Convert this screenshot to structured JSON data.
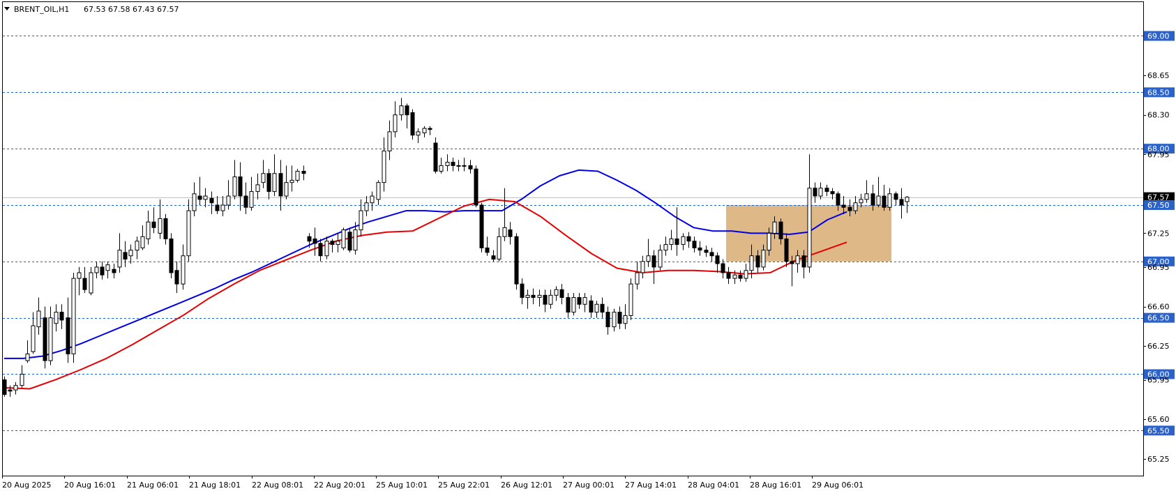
{
  "header": {
    "symbol": "BRENT_OIL,H1",
    "ohlc": "67.53 67.58 67.43 67.57"
  },
  "colors": {
    "background": "#ffffff",
    "frame": "#000000",
    "level_line": "#1f5fc8",
    "level_tag": "#2a62c9",
    "current_price_line": "#c0c0c0",
    "current_price_tag": "#000000",
    "ma_fast": "#0000e6",
    "ma_slow": "#e60000",
    "zone_fill": "#deb887",
    "candle_bull_body": "#ffffff",
    "candle_bear_body": "#000000"
  },
  "icons": {
    "menu": "triangle-down-icon"
  },
  "chart_data": {
    "type": "candlestick",
    "timeframe": "H1",
    "ylim": [
      65.1,
      69.3
    ],
    "y_ticks": [
      "69.00",
      "68.65",
      "68.50",
      "68.30",
      "68.00",
      "67.95",
      "67.57",
      "67.50",
      "67.25",
      "67.00",
      "66.95",
      "66.60",
      "66.50",
      "66.25",
      "66.00",
      "65.95",
      "65.60",
      "65.50",
      "65.25"
    ],
    "x_tick_labels": [
      "20 Aug 2025",
      "20 Aug 16:01",
      "21 Aug 06:01",
      "21 Aug 18:01",
      "22 Aug 08:01",
      "22 Aug 20:01",
      "25 Aug 10:01",
      "25 Aug 22:01",
      "26 Aug 12:01",
      "27 Aug 00:01",
      "27 Aug 14:01",
      "28 Aug 04:01",
      "28 Aug 16:01",
      "29 Aug 06:01"
    ],
    "horizontal_levels": [
      "69.00",
      "68.50",
      "68.00",
      "67.50",
      "67.00",
      "66.50",
      "66.00",
      "65.50"
    ],
    "current_price": "67.57",
    "zone": {
      "time_start": "28 Aug 04:01",
      "time_end": "29 Aug 06:01",
      "price_high": 67.5,
      "price_low": 67.0
    },
    "series": [
      {
        "type": "moving-average",
        "color": "#0000e6",
        "values": [
          66.14,
          66.14,
          66.16,
          66.21,
          66.27,
          66.34,
          66.41,
          66.48,
          66.55,
          66.62,
          66.69,
          66.76,
          66.84,
          66.91,
          66.99,
          67.07,
          67.15,
          67.22,
          67.29,
          67.35,
          67.4,
          67.45,
          67.45,
          67.44,
          67.45,
          67.45,
          67.45,
          67.55,
          67.67,
          67.76,
          67.81,
          67.8,
          67.72,
          67.63,
          67.52,
          67.4,
          67.3,
          67.27,
          67.27,
          67.25,
          67.25,
          67.24,
          67.26,
          67.37,
          67.44
        ],
        "x": [
          "20 Aug 2025",
          "",
          "20 Aug 16:01",
          "",
          "21 Aug 06:01",
          "",
          "21 Aug 18:01",
          "",
          "22 Aug 08:01",
          "",
          "22 Aug 20:01",
          "",
          "25 Aug 10:01",
          "",
          "25 Aug 22:01",
          "",
          "26 Aug 12:01",
          "",
          "27 Aug 00:01",
          "",
          "27 Aug 14:01",
          "",
          "28 Aug 04:01",
          "",
          "28 Aug 16:01",
          "",
          "29 Aug 06:01",
          "",
          "",
          "",
          "",
          "",
          "",
          "",
          "",
          "",
          "",
          "",
          "",
          "",
          "",
          "",
          "",
          "",
          ""
        ]
      },
      {
        "type": "moving-average",
        "color": "#e60000",
        "values": [
          65.88,
          65.87,
          65.95,
          66.04,
          66.14,
          66.26,
          66.39,
          66.52,
          66.67,
          66.8,
          66.92,
          67.01,
          67.1,
          67.18,
          67.23,
          67.26,
          67.27,
          67.38,
          67.49,
          67.55,
          67.53,
          67.4,
          67.23,
          67.07,
          66.94,
          66.9,
          66.92,
          66.92,
          66.91,
          66.89,
          66.9,
          67.01,
          67.09,
          67.17
        ],
        "x": [
          "",
          "",
          "",
          "",
          "",
          "",
          "",
          "",
          "",
          "",
          "",
          "",
          "",
          "",
          "",
          "",
          "",
          "",
          "",
          "",
          "",
          "",
          "",
          "",
          "",
          "",
          "",
          "",
          "",
          "",
          "",
          "",
          "",
          ""
        ]
      }
    ],
    "candles": [
      [
        65.95,
        65.82,
        65.98,
        65.8
      ],
      [
        65.86,
        65.85,
        65.9,
        65.8
      ],
      [
        65.86,
        65.9,
        65.93,
        65.82
      ],
      [
        65.9,
        66.0,
        66.08,
        65.88
      ],
      [
        66.12,
        66.18,
        66.3,
        66.1
      ],
      [
        66.2,
        66.43,
        66.55,
        66.18
      ],
      [
        66.42,
        66.56,
        66.68,
        66.35
      ],
      [
        66.5,
        66.12,
        66.6,
        66.05
      ],
      [
        66.12,
        66.5,
        66.6,
        66.08
      ],
      [
        66.45,
        66.55,
        66.62,
        66.38
      ],
      [
        66.55,
        66.48,
        66.62,
        66.4
      ],
      [
        66.5,
        66.18,
        66.68,
        66.1
      ],
      [
        66.18,
        66.85,
        66.9,
        66.1
      ],
      [
        66.85,
        66.9,
        66.95,
        66.7
      ],
      [
        66.85,
        66.75,
        66.95,
        66.72
      ],
      [
        66.72,
        66.9,
        66.95,
        66.7
      ],
      [
        66.9,
        66.95,
        67.0,
        66.85
      ],
      [
        66.95,
        66.88,
        67.0,
        66.84
      ],
      [
        66.92,
        66.97,
        67.0,
        66.85
      ],
      [
        66.93,
        66.9,
        66.98,
        66.85
      ],
      [
        66.95,
        67.1,
        67.25,
        66.9
      ],
      [
        67.08,
        67.02,
        67.18,
        66.95
      ],
      [
        67.05,
        67.1,
        67.15,
        66.98
      ],
      [
        67.1,
        67.18,
        67.22,
        67.02
      ],
      [
        67.12,
        67.22,
        67.32,
        67.1
      ],
      [
        67.2,
        67.35,
        67.45,
        67.15
      ],
      [
        67.35,
        67.3,
        67.48,
        67.25
      ],
      [
        67.25,
        67.38,
        67.55,
        67.2
      ],
      [
        67.38,
        67.2,
        67.42,
        67.15
      ],
      [
        67.2,
        66.9,
        67.25,
        66.85
      ],
      [
        66.92,
        66.8,
        67.0,
        66.72
      ],
      [
        66.8,
        67.05,
        67.15,
        66.75
      ],
      [
        67.05,
        67.45,
        67.55,
        67.0
      ],
      [
        67.45,
        67.6,
        67.7,
        67.4
      ],
      [
        67.58,
        67.55,
        67.75,
        67.5
      ],
      [
        67.55,
        67.58,
        67.65,
        67.48
      ],
      [
        67.56,
        67.52,
        67.62,
        67.42
      ],
      [
        67.5,
        67.45,
        67.58,
        67.42
      ],
      [
        67.45,
        67.5,
        67.58,
        67.4
      ],
      [
        67.5,
        67.58,
        67.72,
        67.46
      ],
      [
        67.58,
        67.75,
        67.9,
        67.55
      ],
      [
        67.75,
        67.58,
        67.88,
        67.45
      ],
      [
        67.58,
        67.48,
        67.7,
        67.42
      ],
      [
        67.48,
        67.62,
        67.75,
        67.45
      ],
      [
        67.62,
        67.68,
        67.78,
        67.55
      ],
      [
        67.7,
        67.78,
        67.9,
        67.65
      ],
      [
        67.78,
        67.62,
        67.82,
        67.55
      ],
      [
        67.62,
        67.78,
        67.95,
        67.58
      ],
      [
        67.78,
        67.58,
        67.9,
        67.45
      ],
      [
        67.58,
        67.7,
        67.85,
        67.55
      ],
      [
        67.7,
        67.72,
        67.85,
        67.62
      ],
      [
        67.72,
        67.8,
        67.82,
        67.7
      ],
      [
        67.8,
        67.78,
        67.85,
        67.72
      ],
      [
        67.22,
        67.18,
        67.25,
        67.12
      ],
      [
        67.2,
        67.16,
        67.3,
        67.05
      ],
      [
        67.16,
        67.05,
        67.2,
        67.0
      ],
      [
        67.05,
        67.18,
        67.22,
        67.02
      ],
      [
        67.18,
        67.15,
        67.2,
        67.08
      ],
      [
        67.15,
        67.18,
        67.25,
        67.08
      ],
      [
        67.12,
        67.28,
        67.3,
        67.1
      ],
      [
        67.26,
        67.1,
        67.3,
        67.08
      ],
      [
        67.1,
        67.28,
        67.35,
        67.06
      ],
      [
        67.28,
        67.45,
        67.55,
        67.22
      ],
      [
        67.45,
        67.52,
        67.58,
        67.4
      ],
      [
        67.52,
        67.58,
        67.62,
        67.45
      ],
      [
        67.55,
        67.7,
        67.72,
        67.5
      ],
      [
        67.7,
        67.98,
        68.1,
        67.62
      ],
      [
        67.98,
        68.15,
        68.25,
        67.9
      ],
      [
        68.15,
        68.3,
        68.42,
        68.1
      ],
      [
        68.3,
        68.38,
        68.45,
        68.25
      ],
      [
        68.38,
        68.3,
        68.4,
        68.18
      ],
      [
        68.32,
        68.12,
        68.35,
        68.08
      ],
      [
        68.12,
        68.15,
        68.18,
        68.05
      ],
      [
        68.14,
        68.18,
        68.2,
        68.1
      ],
      [
        68.18,
        68.17,
        68.2,
        68.12
      ],
      [
        68.05,
        67.8,
        68.1,
        67.78
      ],
      [
        67.8,
        67.85,
        67.92,
        67.78
      ],
      [
        67.85,
        67.88,
        67.95,
        67.8
      ],
      [
        67.88,
        67.85,
        67.92,
        67.8
      ],
      [
        67.85,
        67.85,
        67.9,
        67.8
      ],
      [
        67.85,
        67.85,
        67.92,
        67.8
      ],
      [
        67.85,
        67.82,
        67.9,
        67.78
      ],
      [
        67.82,
        67.5,
        67.85,
        67.48
      ],
      [
        67.5,
        67.12,
        67.52,
        67.08
      ],
      [
        67.12,
        67.08,
        67.22,
        67.05
      ],
      [
        67.05,
        67.02,
        67.1,
        67.0
      ],
      [
        67.02,
        67.22,
        67.3,
        67.0
      ],
      [
        67.22,
        67.3,
        67.65,
        67.18
      ],
      [
        67.28,
        67.22,
        67.35,
        67.15
      ],
      [
        67.22,
        66.8,
        67.25,
        66.75
      ],
      [
        66.8,
        66.68,
        66.85,
        66.62
      ],
      [
        66.68,
        66.7,
        66.75,
        66.58
      ],
      [
        66.7,
        66.68,
        66.76,
        66.62
      ],
      [
        66.68,
        66.7,
        66.75,
        66.6
      ],
      [
        66.7,
        66.62,
        66.75,
        66.55
      ],
      [
        66.62,
        66.7,
        66.75,
        66.58
      ],
      [
        66.7,
        66.75,
        66.78,
        66.65
      ],
      [
        66.75,
        66.68,
        66.8,
        66.62
      ],
      [
        66.68,
        66.55,
        66.72,
        66.5
      ],
      [
        66.55,
        66.68,
        66.72,
        66.52
      ],
      [
        66.68,
        66.62,
        66.72,
        66.58
      ],
      [
        66.62,
        66.68,
        66.72,
        66.55
      ],
      [
        66.65,
        66.55,
        66.7,
        66.5
      ],
      [
        66.55,
        66.62,
        66.65,
        66.5
      ],
      [
        66.62,
        66.55,
        66.68,
        66.5
      ],
      [
        66.55,
        66.42,
        66.6,
        66.35
      ],
      [
        66.42,
        66.55,
        66.58,
        66.38
      ],
      [
        66.55,
        66.45,
        66.6,
        66.4
      ],
      [
        66.45,
        66.52,
        66.62,
        66.4
      ],
      [
        66.52,
        66.8,
        66.85,
        66.48
      ],
      [
        66.8,
        66.9,
        67.0,
        66.75
      ],
      [
        66.9,
        67.0,
        67.05,
        66.85
      ],
      [
        67.0,
        67.05,
        67.2,
        66.95
      ],
      [
        67.05,
        66.95,
        67.1,
        66.8
      ],
      [
        66.95,
        67.1,
        67.15,
        66.92
      ],
      [
        67.1,
        67.15,
        67.22,
        67.05
      ],
      [
        67.15,
        67.2,
        67.28,
        67.1
      ],
      [
        67.2,
        67.15,
        67.48,
        67.05
      ],
      [
        67.15,
        67.22,
        67.25,
        67.1
      ],
      [
        67.22,
        67.18,
        67.26,
        67.12
      ],
      [
        67.18,
        67.12,
        67.22,
        67.08
      ],
      [
        67.12,
        67.1,
        67.18,
        67.05
      ],
      [
        67.1,
        67.08,
        67.14,
        67.04
      ],
      [
        67.08,
        67.05,
        67.12,
        67.0
      ],
      [
        67.05,
        66.98,
        67.08,
        66.9
      ],
      [
        66.98,
        66.9,
        67.02,
        66.85
      ],
      [
        66.9,
        66.85,
        66.95,
        66.8
      ],
      [
        66.85,
        66.88,
        66.92,
        66.8
      ],
      [
        66.88,
        66.85,
        66.92,
        66.82
      ],
      [
        66.85,
        66.92,
        66.98,
        66.82
      ],
      [
        66.92,
        67.05,
        67.15,
        66.85
      ],
      [
        67.05,
        66.95,
        67.1,
        66.9
      ],
      [
        66.95,
        67.1,
        67.15,
        66.92
      ],
      [
        67.1,
        67.25,
        67.3,
        67.05
      ],
      [
        67.25,
        67.35,
        67.4,
        67.2
      ],
      [
        67.35,
        67.2,
        67.38,
        67.15
      ],
      [
        67.2,
        67.0,
        67.25,
        66.95
      ],
      [
        67.0,
        66.98,
        67.05,
        66.78
      ],
      [
        66.98,
        67.05,
        67.1,
        66.9
      ],
      [
        67.05,
        66.95,
        67.1,
        66.85
      ],
      [
        66.95,
        67.65,
        67.95,
        66.9
      ],
      [
        67.65,
        67.58,
        67.7,
        67.52
      ],
      [
        67.58,
        67.65,
        67.7,
        67.55
      ],
      [
        67.65,
        67.62,
        67.68,
        67.58
      ],
      [
        67.62,
        67.6,
        67.65,
        67.55
      ],
      [
        67.6,
        67.5,
        67.62,
        67.45
      ],
      [
        67.5,
        67.48,
        67.58,
        67.42
      ],
      [
        67.48,
        67.45,
        67.55,
        67.4
      ],
      [
        67.45,
        67.52,
        67.58,
        67.42
      ],
      [
        67.52,
        67.55,
        67.6,
        67.48
      ],
      [
        67.55,
        67.6,
        67.72,
        67.52
      ],
      [
        67.6,
        67.5,
        67.68,
        67.45
      ],
      [
        67.5,
        67.58,
        67.75,
        67.48
      ],
      [
        67.58,
        67.48,
        67.68,
        67.45
      ],
      [
        67.48,
        67.6,
        67.65,
        67.45
      ],
      [
        67.6,
        67.55,
        67.62,
        67.5
      ],
      [
        67.55,
        67.5,
        67.65,
        67.38
      ],
      [
        67.53,
        67.57,
        67.58,
        67.43
      ]
    ]
  }
}
